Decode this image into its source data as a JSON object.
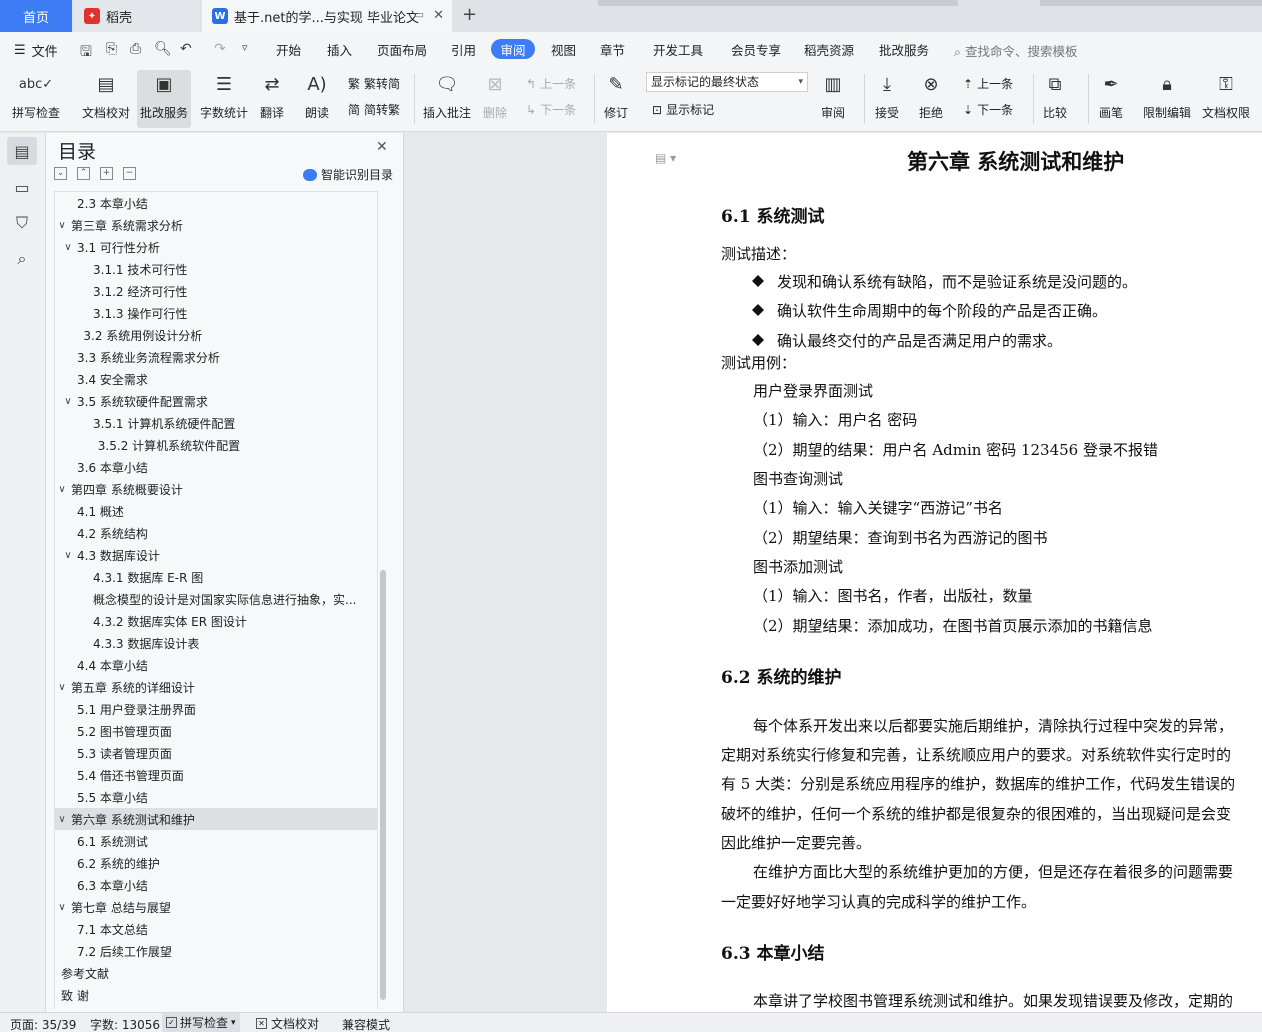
{
  "tabs": {
    "home": "首页",
    "daoke": "稻壳",
    "doc": "基于.net的学...与实现 毕业论文"
  },
  "menu": {
    "file": "文件",
    "tabs": [
      "开始",
      "插入",
      "页面布局",
      "引用",
      "审阅",
      "视图",
      "章节",
      "开发工具",
      "会员专享",
      "稻壳资源",
      "批改服务"
    ],
    "active": "审阅",
    "search": "查找命令、搜索模板"
  },
  "ribbon": {
    "spell": "拼写检查",
    "doc_check": "文档校对",
    "correction": "批改服务",
    "word_count": "字数统计",
    "translate": "翻译",
    "read": "朗读",
    "to_trad": "繁转简",
    "to_simp": "简转繁",
    "insert_comment": "插入批注",
    "delete": "删除",
    "prev_comment": "上一条",
    "next_comment": "下一条",
    "track": "修订",
    "markup_state": "显示标记的最终状态",
    "show_markup": "显示标记",
    "review": "审阅",
    "accept": "接受",
    "reject": "拒绝",
    "prev": "上一条",
    "next": "下一条",
    "compare": "比较",
    "pen": "画笔",
    "restrict": "限制编辑",
    "doc_perm": "文档权限"
  },
  "outline": {
    "title": "目录",
    "smart": "智能识别目录",
    "items": [
      {
        "text": "2.3 本章小结",
        "level": 1,
        "chev": ""
      },
      {
        "text": "第三章  系统需求分析",
        "level": 0,
        "chev": "v"
      },
      {
        "text": "3.1 可行性分析",
        "level": 1,
        "chev": "v"
      },
      {
        "text": "3.1.1 技术可行性",
        "level": 2,
        "chev": ""
      },
      {
        "text": "3.1.2  经济可行性",
        "level": 2,
        "chev": ""
      },
      {
        "text": "3.1.3 操作可行性",
        "level": 2,
        "chev": ""
      },
      {
        "text": "3.2 系统用例设计分析",
        "level": 1.4,
        "chev": ""
      },
      {
        "text": "3.3 系统业务流程需求分析",
        "level": 1,
        "chev": ""
      },
      {
        "text": "3.4 安全需求",
        "level": 1,
        "chev": ""
      },
      {
        "text": "3.5 系统软硬件配置需求",
        "level": 1,
        "chev": "v"
      },
      {
        "text": "3.5.1 计算机系统硬件配置",
        "level": 2,
        "chev": ""
      },
      {
        "text": "3.5.2 计算机系统软件配置",
        "level": 2.3,
        "chev": ""
      },
      {
        "text": "3.6 本章小结",
        "level": 1,
        "chev": ""
      },
      {
        "text": "第四章  系统概要设计",
        "level": 0,
        "chev": "v"
      },
      {
        "text": "4.1 概述",
        "level": 1,
        "chev": ""
      },
      {
        "text": "4.2 系统结构",
        "level": 1,
        "chev": ""
      },
      {
        "text": "4.3 数据库设计",
        "level": 1,
        "chev": "v"
      },
      {
        "text": "4.3.1 数据库 E-R 图",
        "level": 2,
        "chev": ""
      },
      {
        "text": "概念模型的设计是对国家实际信息进行抽象，实...",
        "level": 2,
        "chev": ""
      },
      {
        "text": "4.3.2 数据库实体 ER 图设计",
        "level": 2,
        "chev": ""
      },
      {
        "text": "4.3.3 数据库设计表",
        "level": 2,
        "chev": ""
      },
      {
        "text": "4.4 本章小结",
        "level": 1,
        "chev": ""
      },
      {
        "text": "第五章  系统的详细设计",
        "level": 0,
        "chev": "v"
      },
      {
        "text": "5.1 用户登录注册界面",
        "level": 1,
        "chev": ""
      },
      {
        "text": "5.2 图书管理页面",
        "level": 1,
        "chev": ""
      },
      {
        "text": "5.3  读者管理页面",
        "level": 1,
        "chev": ""
      },
      {
        "text": "5.4 借还书管理页面",
        "level": 1,
        "chev": ""
      },
      {
        "text": "5.5 本章小结",
        "level": 1,
        "chev": ""
      },
      {
        "text": "第六章  系统测试和维护",
        "level": 0,
        "chev": "v",
        "selected": true
      },
      {
        "text": "6.1 系统测试",
        "level": 1,
        "chev": ""
      },
      {
        "text": "6.2 系统的维护",
        "level": 1,
        "chev": ""
      },
      {
        "text": "6.3 本章小结",
        "level": 1,
        "chev": ""
      },
      {
        "text": "第七章  总结与展望",
        "level": 0,
        "chev": "v"
      },
      {
        "text": "7.1 本文总结",
        "level": 1,
        "chev": ""
      },
      {
        "text": "7.2 后续工作展望",
        "level": 1,
        "chev": ""
      },
      {
        "text": "参考文献",
        "level": 0,
        "chev": ""
      },
      {
        "text": "致     谢",
        "level": 0,
        "chev": ""
      }
    ]
  },
  "document": {
    "chapter_title": "第六章  系统测试和维护",
    "s61": "6.1 系统测试",
    "test_desc": "测试描述：",
    "bullets": [
      "发现和确认系统有缺陷，而不是验证系统是没问题的。",
      "确认软件生命周期中的每个阶段的产品是否正确。",
      "确认最终交付的产品是否满足用户的需求。"
    ],
    "test_cases": "测试用例：",
    "login_test": "用户登录界面测试",
    "login_in": "（1）输入：用户名  密码",
    "login_out": "（2）期望的结果：用户名 Admin  密码 123456  登录不报错",
    "query_test": "图书查询测试",
    "query_in": "（1）输入：输入关键字“西游记”书名",
    "query_out": "（2）期望结果：查询到书名为西游记的图书",
    "add_test": "图书添加测试",
    "add_in": "（1）输入：图书名，作者，出版社，数量",
    "add_out": "（2）期望结果：添加成功，在图书首页展示添加的书籍信息",
    "s62": "6.2 系统的维护",
    "p1": [
      "每个体系开发出来以后都要实施后期维护，清除执行过程中突发的异常，",
      "定期对系统实行修复和完善，让系统顺应用户的要求。对系统软件实行定时的",
      "有 5 大类：分别是系统应用程序的维护，数据库的维护工作，代码发生错误的",
      "破坏的维护，任何一个系统的维护都是很复杂的很困难的，当出现疑问是会变",
      "因此维护一定要完善。"
    ],
    "p2": [
      "在维护方面比大型的系统维护更加的方便，但是还存在着很多的问题需要",
      "一定要好好地学习认真的完成科学的维护工作。"
    ],
    "s63": "6.3 本章小结",
    "p3": "本章讲了学校图书管理系统测试和维护。如果发现错误要及修改，定期的"
  },
  "status": {
    "page": "页面: 35/39",
    "words": "字数: 13056",
    "spell": "拼写检查",
    "proof": "文档校对",
    "compat": "兼容模式"
  },
  "colors": {
    "accent": "#3d7cf5",
    "daoke_logo": "#e0322a",
    "doc_logo": "#2b6fe6"
  }
}
